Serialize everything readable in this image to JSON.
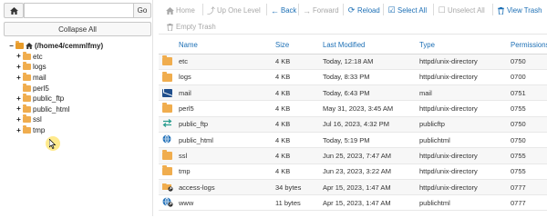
{
  "left_panel": {
    "home_icon": "home-icon",
    "path_input_value": "",
    "go_label": "Go",
    "collapse_label": "Collapse All",
    "tree_root": "(/home4/cemmlfmy)",
    "tree_items": [
      {
        "label": "etc",
        "expandable": "+"
      },
      {
        "label": "logs",
        "expandable": "+"
      },
      {
        "label": "mail",
        "expandable": "+"
      },
      {
        "label": "perl5",
        "expandable": ""
      },
      {
        "label": "public_ftp",
        "expandable": "+"
      },
      {
        "label": "public_html",
        "expandable": "+"
      },
      {
        "label": "ssl",
        "expandable": "+"
      },
      {
        "label": "tmp",
        "expandable": "+"
      }
    ]
  },
  "toolbar": {
    "home": "Home",
    "up_one_level": "Up One Level",
    "back": "Back",
    "forward": "Forward",
    "reload": "Reload",
    "select_all": "Select All",
    "unselect_all": "Unselect All",
    "view_trash": "View Trash",
    "empty_trash": "Empty Trash"
  },
  "table": {
    "headers": {
      "name": "Name",
      "size": "Size",
      "modified": "Last Modified",
      "type": "Type",
      "perm": "Permissions"
    },
    "rows": [
      {
        "icon": "folder",
        "name": "etc",
        "size": "4 KB",
        "modified": "Today, 12:18 AM",
        "type": "httpd/unix-directory",
        "perm": "0750"
      },
      {
        "icon": "folder",
        "name": "logs",
        "size": "4 KB",
        "modified": "Today, 8:33 PM",
        "type": "httpd/unix-directory",
        "perm": "0700"
      },
      {
        "icon": "mail",
        "name": "mail",
        "size": "4 KB",
        "modified": "Today, 6:43 PM",
        "type": "mail",
        "perm": "0751"
      },
      {
        "icon": "folder",
        "name": "perl5",
        "size": "4 KB",
        "modified": "May 31, 2023, 3:45 AM",
        "type": "httpd/unix-directory",
        "perm": "0755"
      },
      {
        "icon": "ftp",
        "name": "public_ftp",
        "size": "4 KB",
        "modified": "Jul 16, 2023, 4:32 PM",
        "type": "publicftp",
        "perm": "0750"
      },
      {
        "icon": "globe",
        "name": "public_html",
        "size": "4 KB",
        "modified": "Today, 5:19 PM",
        "type": "publichtml",
        "perm": "0750"
      },
      {
        "icon": "folder",
        "name": "ssl",
        "size": "4 KB",
        "modified": "Jun 25, 2023, 7:47 AM",
        "type": "httpd/unix-directory",
        "perm": "0755"
      },
      {
        "icon": "folder",
        "name": "tmp",
        "size": "4 KB",
        "modified": "Jun 23, 2023, 3:22 AM",
        "type": "httpd/unix-directory",
        "perm": "0755"
      },
      {
        "icon": "folder-link",
        "name": "access-logs",
        "size": "34 bytes",
        "modified": "Apr 15, 2023, 1:47 AM",
        "type": "httpd/unix-directory",
        "perm": "0777"
      },
      {
        "icon": "globe-link",
        "name": "www",
        "size": "11 bytes",
        "modified": "Apr 15, 2023, 1:47 AM",
        "type": "publichtml",
        "perm": "0777"
      }
    ]
  },
  "colors": {
    "accent": "#1c6fb5",
    "folder": "#f0ad4e",
    "disabled": "#a8a8a8"
  }
}
